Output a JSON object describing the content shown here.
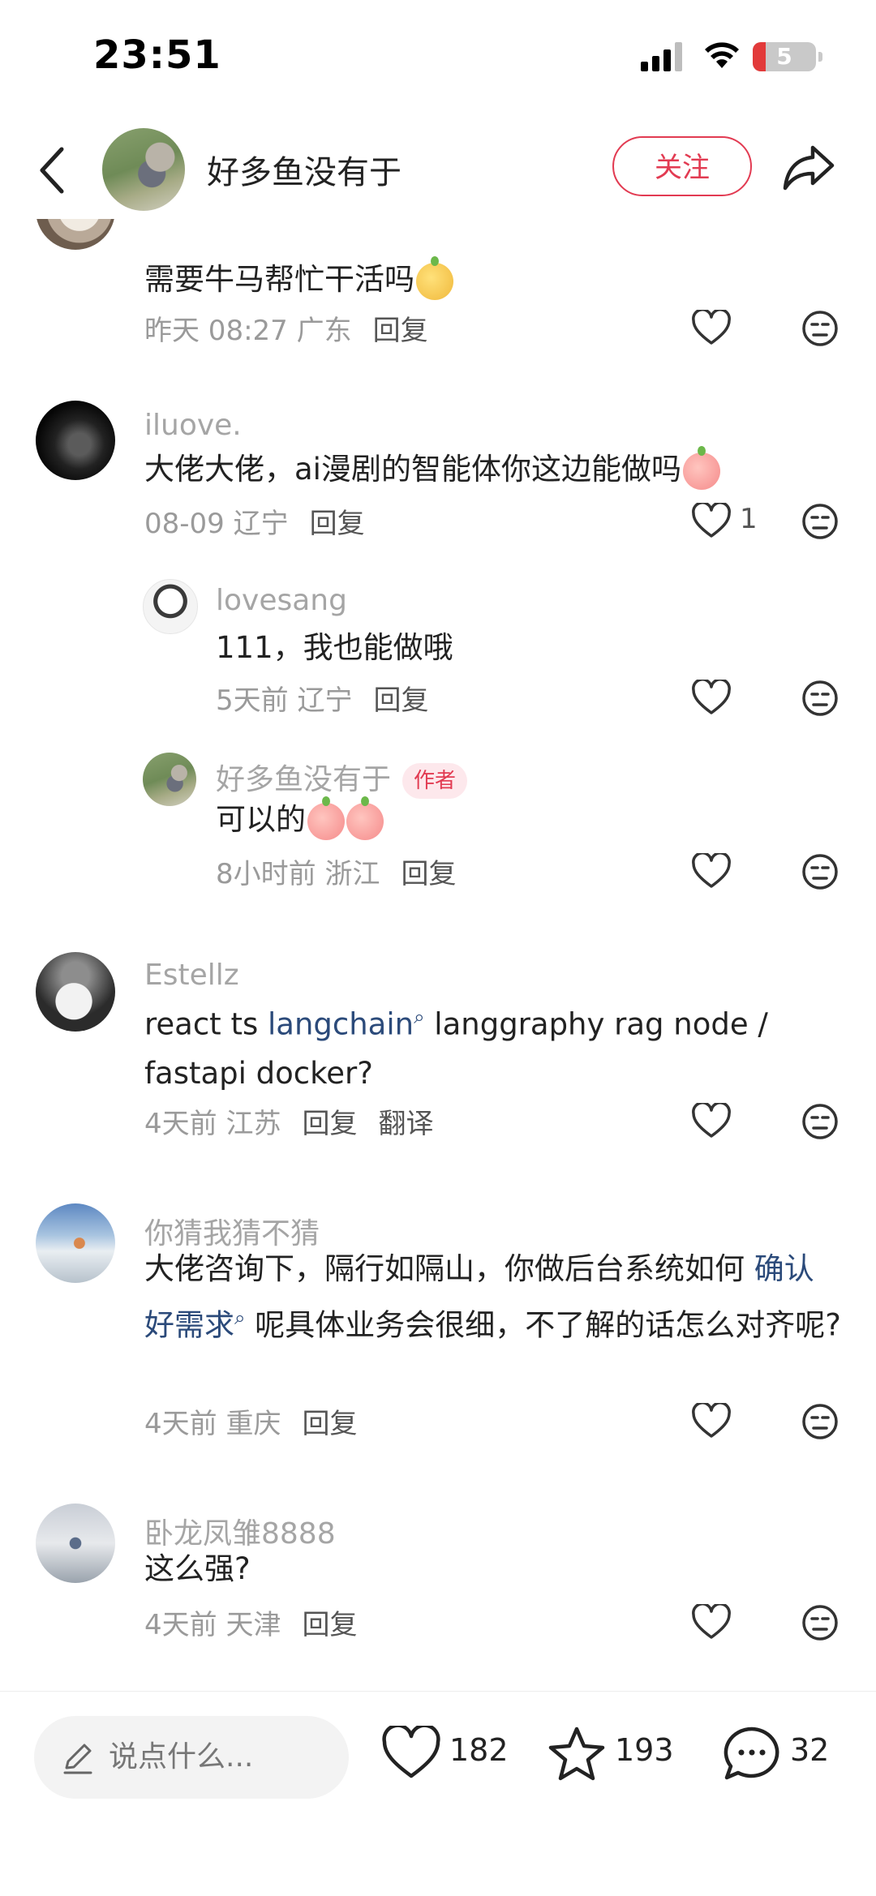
{
  "status": {
    "time": "23:51",
    "battery": "5"
  },
  "header": {
    "username": "好多鱼没有于",
    "follow_label": "关注"
  },
  "comments": [
    {
      "text": "需要牛马帮忙干活吗",
      "date": "昨天 08:27",
      "region": "广东",
      "reply": "回复"
    },
    {
      "username": "iluove.",
      "text": "大佬大佬，ai漫剧的智能体你这边能做吗",
      "date": "08-09",
      "region": "辽宁",
      "reply": "回复",
      "likes": "1"
    },
    {
      "username": "lovesang",
      "text": "111，我也能做哦",
      "date": "5天前",
      "region": "辽宁",
      "reply": "回复"
    },
    {
      "username": "好多鱼没有于",
      "tag": "作者",
      "text": "可以的",
      "date": "8小时前",
      "region": "浙江",
      "reply": "回复"
    },
    {
      "username": "Estellz",
      "text_a": "react ts ",
      "link": "langchain",
      "text_b": " langgraphy rag  node / fastapi docker?",
      "date": "4天前",
      "region": "江苏",
      "reply": "回复",
      "translate": "翻译"
    },
    {
      "username": "你猜我猜不猜",
      "text_a": "大佬咨询下，隔行如隔山，你做后台系统如何 ",
      "link": "确认好需求",
      "text_b": " 呢具体业务会很细，不了解的话怎么对齐呢?",
      "date": "4天前",
      "region": "重庆",
      "reply": "回复"
    },
    {
      "username": "卧龙凤雏8888",
      "text": "这么强?",
      "date": "4天前",
      "region": "天津",
      "reply": "回复"
    }
  ],
  "bottom_bar": {
    "input_placeholder": "说点什么...",
    "likes": "182",
    "favorites": "193",
    "comments": "32"
  }
}
